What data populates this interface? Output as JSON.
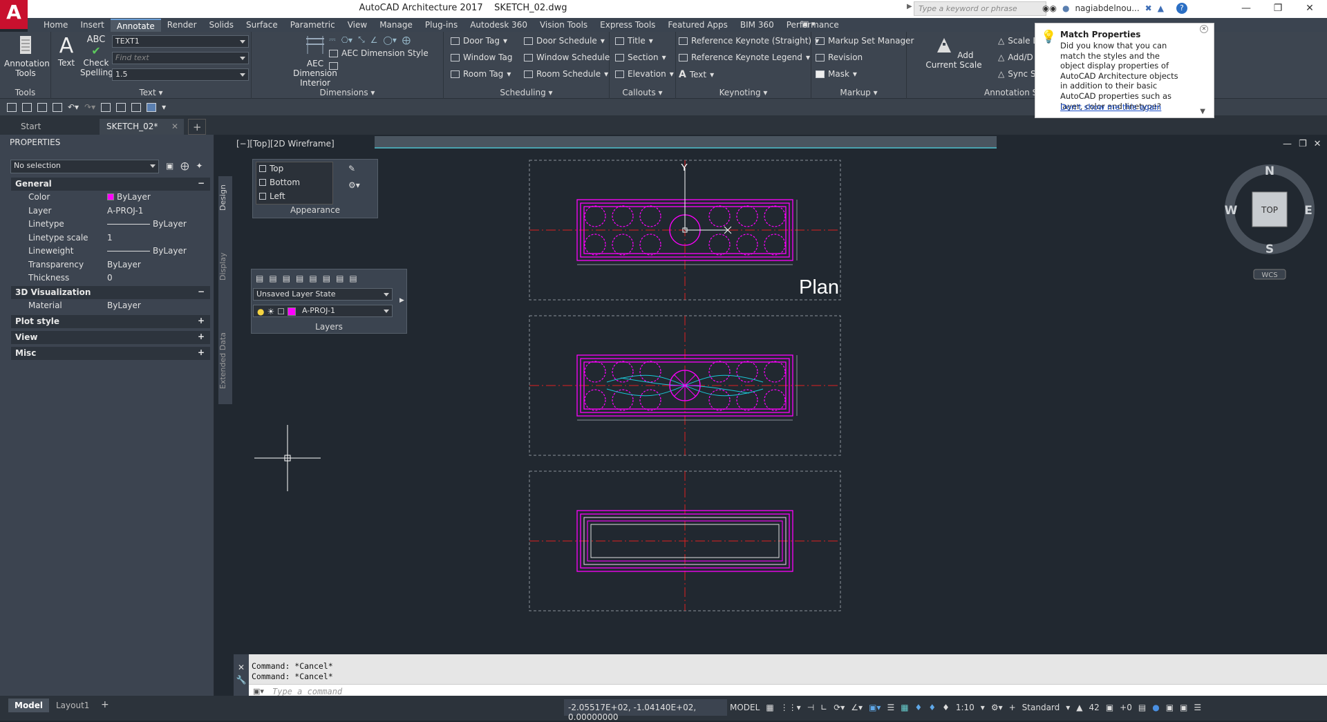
{
  "app": {
    "title": "AutoCAD Architecture 2017",
    "file": "SKETCH_02.dwg",
    "logo": "A"
  },
  "search": {
    "placeholder": "Type a keyword or phrase"
  },
  "user": {
    "name": "nagiabdelnou..."
  },
  "ribbon_tabs": [
    "Home",
    "Insert",
    "Annotate",
    "Render",
    "Solids",
    "Surface",
    "Parametric",
    "View",
    "Manage",
    "Plug-ins",
    "Autodesk 360",
    "Vision Tools",
    "Express Tools",
    "Featured Apps",
    "BIM 360",
    "Performance"
  ],
  "ribbon": {
    "tools": {
      "label": "Tools",
      "button": "Annotation Tools"
    },
    "text": {
      "label": "Text",
      "text_btn": "Text",
      "check_btn": "Check Spelling",
      "style": "TEXT1",
      "find_placeholder": "Find text",
      "height": "1.5"
    },
    "dimensions": {
      "label": "Dimensions",
      "aec_interior": "AEC Dimension Interior",
      "aec_style": "AEC Dimension Style"
    },
    "scheduling": {
      "label": "Scheduling",
      "items": [
        "Door Tag",
        "Window Tag",
        "Room Tag",
        "Door Schedule",
        "Window Schedule",
        "Room Schedule"
      ]
    },
    "callouts": {
      "label": "Callouts",
      "items": [
        "Title",
        "Section",
        "Elevation"
      ]
    },
    "keynoting": {
      "label": "Keynoting",
      "items": [
        "Reference Keynote (Straight)",
        "Reference Keynote Legend",
        "Text"
      ]
    },
    "markup": {
      "label": "Markup",
      "items": [
        "Markup Set Manager",
        "Revision",
        "Mask"
      ]
    },
    "annotation_scaling": {
      "label": "Annotation Scaling",
      "add_current_scale": "Add Current Scale",
      "items": [
        "Scale L",
        "Add/D",
        "Sync S"
      ]
    }
  },
  "doc_tabs": [
    "Start",
    "SKETCH_02*"
  ],
  "properties": {
    "title": "PROPERTIES",
    "selection": "No selection",
    "general": {
      "title": "General",
      "rows": [
        {
          "k": "Color",
          "v": "ByLayer"
        },
        {
          "k": "Layer",
          "v": "A-PROJ-1"
        },
        {
          "k": "Linetype",
          "v": "ByLayer"
        },
        {
          "k": "Linetype scale",
          "v": "1"
        },
        {
          "k": "Lineweight",
          "v": "ByLayer"
        },
        {
          "k": "Transparency",
          "v": "ByLayer"
        },
        {
          "k": "Thickness",
          "v": "0"
        }
      ]
    },
    "viz": {
      "title": "3D Visualization",
      "rows": [
        {
          "k": "Material",
          "v": "ByLayer"
        }
      ]
    },
    "collapsed": [
      "Plot style",
      "View",
      "Misc"
    ],
    "side_tabs": [
      "Design",
      "Display",
      "Extended Data"
    ]
  },
  "viewport": {
    "label": "[−][Top][2D Wireframe]",
    "plan_label": "Plan",
    "y_axis": "Y"
  },
  "appearance": {
    "title": "Appearance",
    "items": [
      "Top",
      "Bottom",
      "Left"
    ]
  },
  "layers": {
    "title": "Layers",
    "state": "Unsaved Layer State",
    "current": "A-PROJ-1"
  },
  "viewcube": {
    "N": "N",
    "S": "S",
    "E": "E",
    "W": "W",
    "face": "TOP",
    "ucs": "WCS"
  },
  "tooltip": {
    "title": "Match Properties",
    "body": "Did you know that you can match the styles and the object display properties of AutoCAD Architecture objects in addition to their basic AutoCAD properties such as layer, color and linetype?",
    "link": "Don't show me this again"
  },
  "command": {
    "history": [
      "Command: *Cancel*",
      "Command: *Cancel*"
    ],
    "placeholder": "Type a command"
  },
  "layout_tabs": [
    "Model",
    "Layout1"
  ],
  "status": {
    "coords": "-2.05517E+02, -1.04140E+02, 0.00000000",
    "model": "MODEL",
    "scale": "1:10",
    "style": "Standard",
    "number": "42",
    "offset": "+0"
  },
  "colors": {
    "accent": "#ff00ff",
    "cut_line": "#e02020",
    "flow": "#1cc8d8"
  }
}
